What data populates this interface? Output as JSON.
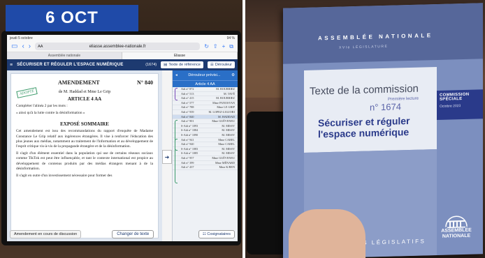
{
  "date_badge": "6 OCT",
  "tablet": {
    "status": {
      "time": "jeudi 5 octobre",
      "battery": "94 %"
    },
    "url": {
      "aa": "AA",
      "address": "eliasse.assemblee-nationale.fr"
    },
    "tabs": [
      "Assemblée nationale",
      "Eliasse"
    ],
    "header": {
      "title": "SÉCURISER ET RÉGULER L'ESPACE NUMÉRIQUE",
      "count": "(1674)",
      "reference_label": "Texte de référence",
      "deroule_label": "Dérouleur"
    },
    "document": {
      "heading": "AMENDEMENT",
      "number": "N° 840",
      "stamp": "ADOPTÉ",
      "authors": "de M. Haddad et Mme Le Grip",
      "article": "ARTICLE 4 AA",
      "paragraphs": [
        "Compléter l'alinéa 2 par les mots :",
        "« ainsi qu'à la lutte contre la désinformation »"
      ],
      "expose_title": "EXPOSÉ SOMMAIRE",
      "expose_paragraphs": [
        "Cet amendement est issu des recommandations du rapport d'enquête de Madame Constance Le Grip relatif aux ingérences étrangères. Il vise à renforcer l'éducation des plus jeunes aux médias, notamment au traitement de l'information et au développement de l'esprit critique vis-à-vis de la propagande étrangère et de la désinformation.",
        "Il s'agit d'un élément essentiel dans la population qui use de certains réseaux sociaux comme TikTok est peut être influençable, et tant le contexte international est propice au développement de contenus produits par des médias étrangers menant à de la désinformation.",
        "Il s'agit en outre d'un investissement nécessaire pour former des"
      ],
      "footer_status": "Amendement en cours de discussion",
      "change_text_label": "Changer de texte"
    },
    "side_panel": {
      "header": "Dérouleur prévisi...",
      "subheader": "Article 4 AA",
      "rows": [
        {
          "amend": "Adt n° 872",
          "author": "M. BOURRIEZ"
        },
        {
          "amend": "Adt n° 513",
          "author": "M. TAVÉ"
        },
        {
          "amend": "Adt n° 415",
          "author": "M. BOURRIEZ"
        },
        {
          "amend": "Adt n° 577",
          "author": "Mme PANOSYAN"
        },
        {
          "amend": "Adt n° 788",
          "author": "Mme LE GRIP"
        },
        {
          "amend": "Adt n° 939",
          "author": "M. LOPEZ-LIGUORI"
        },
        {
          "amend": "Adt n° 840",
          "author": "M. HADDAD"
        },
        {
          "amend": "Adt n° 901",
          "author": "Mme GUÉVENEU"
        },
        {
          "amend": "S-Adt n° 1093",
          "author": "M. MISSY"
        },
        {
          "amend": "S-Adt n° 1084",
          "author": "M. MISSY"
        },
        {
          "amend": "S-Adt n° 1090",
          "author": "M. MISSY"
        },
        {
          "amend": "Adt n° 941",
          "author": "Mme CAREL"
        },
        {
          "amend": "Adt n° 940",
          "author": "Mme CAREL"
        },
        {
          "amend": "S-Adt n° 1083",
          "author": "M. MISSY"
        },
        {
          "amend": "S-Adt n° 1085",
          "author": "M. MISSY"
        },
        {
          "amend": "Adt n° 957",
          "author": "Mme GUÉVENEU"
        },
        {
          "amend": "Adt n° 399",
          "author": "Mme MÉNARD"
        },
        {
          "amend": "Adt n° 437",
          "author": "Mme K/REN"
        }
      ],
      "active_index": 6,
      "footer_label": "Cosignataires"
    }
  },
  "booklet": {
    "institution": "ASSEMBLÉE NATIONALE",
    "legislature": "XVIe LÉGISLATURE",
    "texte": "Texte de la commission",
    "lecture": "Première lecture",
    "number": "n° 1674",
    "title_line1": "Sécuriser et réguler",
    "title_line2": "l'espace numérique",
    "commission": "COMMISSION SPÉCIALE",
    "commission_date": "Octobre 2023",
    "series": "DOCUMENTS LÉGISLATIFS",
    "logo_line1": "ASSEMBLÉE",
    "logo_line2": "NATIONALE"
  }
}
